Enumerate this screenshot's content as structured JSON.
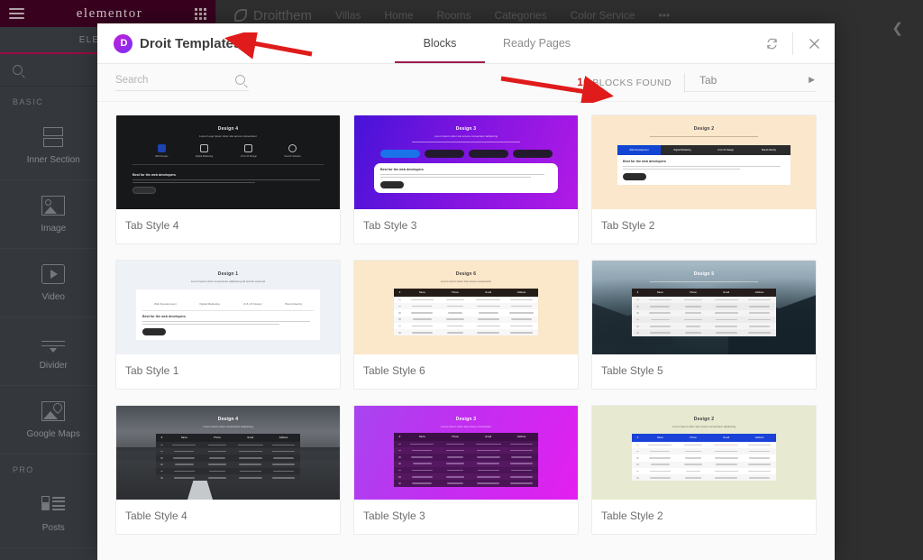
{
  "background": {
    "app_name": "elementor",
    "panel": {
      "tab_label": "ELEMENTS",
      "search_placeholder": "",
      "category_basic": "BASIC",
      "category_pro": "PRO",
      "widgets": [
        {
          "label": "Inner Section",
          "icon": "inner-section-icon"
        },
        {
          "label": "Image",
          "icon": "image-icon"
        },
        {
          "label": "Video",
          "icon": "video-icon"
        },
        {
          "label": "Divider",
          "icon": "divider-icon"
        },
        {
          "label": "Google Maps",
          "icon": "google-maps-icon"
        },
        {
          "label": "Posts",
          "icon": "posts-icon"
        }
      ]
    },
    "site_nav": {
      "brand": "Droitthem",
      "items": [
        "Villas",
        "Home",
        "Rooms",
        "Categories",
        "Color Service"
      ],
      "more_icon": "ellipsis-icon",
      "share_icon": "share-icon"
    }
  },
  "modal": {
    "brand_badge_letter": "D",
    "title": "Droit Templates",
    "tabs": [
      {
        "label": "Blocks",
        "active": true
      },
      {
        "label": "Ready Pages",
        "active": false
      }
    ],
    "refresh_icon": "refresh-icon",
    "close_icon": "close-icon",
    "toolbar": {
      "search_placeholder": "Search",
      "search_value": "",
      "search_icon": "search-icon",
      "results_count": "16",
      "results_label": "BLOCKS FOUND",
      "results_count_color": "#cf2020",
      "filter_value": "Tab",
      "filter_arrow_icon": "chevron-right-icon"
    },
    "cards": [
      {
        "label": "Tab Style 4",
        "thumb": {
          "kind": "tab-icons",
          "title": "Design 4",
          "subtitle": "Lorem Logo Ipsum dolor site amore consectetur",
          "bg": "#17181a",
          "fg": "#e8e8e8",
          "panel_bg": "transparent",
          "icons": [
            "Web Design",
            "Digital Marketing",
            "UI & UX Design",
            "Search Solution"
          ],
          "active_index": 0,
          "accent": "#1d4ed8",
          "heading": "Best for the web developers",
          "button": "Read More"
        }
      },
      {
        "label": "Tab Style 3",
        "thumb": {
          "kind": "tab-pills",
          "title": "Design 3",
          "subtitle": "Lorem Ipsum dolor site amore consectetur adipiscing",
          "bg": "linear-gradient(110deg,#4713d8 0%,#7d14e0 45%,#b31ae6 100%)",
          "fg": "#ffffff",
          "panel_bg": "#ffffff",
          "pills": [
            "Web Development",
            "Digital Marketing",
            "UI & UX Design",
            "Brand Identity"
          ],
          "active_index": 0,
          "accent": "#1a73e8",
          "heading": "Best for the web developers",
          "button": "Read More"
        }
      },
      {
        "label": "Tab Style 2",
        "thumb": {
          "kind": "tab-bar",
          "title": "Design 2",
          "subtitle": "",
          "bg": "#fbe7cb",
          "fg": "#3a3a3a",
          "panel_bg": "#ffffff",
          "bar_bg": "#2b2b2b",
          "tabs": [
            "Web Development",
            "Digital Marketing",
            "UI & UX Design",
            "Brand Identity"
          ],
          "active_index": 0,
          "accent": "#1245d4",
          "heading": "Best for the web developers",
          "button": "Read More"
        }
      },
      {
        "label": "Tab Style 1",
        "thumb": {
          "kind": "tab-plain",
          "title": "Design 1",
          "subtitle": "Lorem Ipsum dolor consectetur adipiscing elit sed do eiusmod",
          "bg": "#eef2f7",
          "fg": "#3a3a3a",
          "panel_bg": "#ffffff",
          "tabs": [
            "Web Development",
            "Digital Marketing",
            "UI & UX Design",
            "Brand Identity"
          ],
          "active_index": 0,
          "heading": "Best for the web developers",
          "button": "Read More"
        }
      },
      {
        "label": "Table Style 6",
        "thumb": {
          "kind": "table",
          "title": "Design 6",
          "subtitle": "Lorem Ipsum dolor site amore consectetur",
          "bg": "#fbe7c9",
          "fg": "#3a3a3a",
          "head_bg": "#241c16",
          "head_fg": "#ffffff",
          "body_bg": "#ffffff",
          "cell_color": "#8a8a8a",
          "columns": [
            "#",
            "Name",
            "Phone",
            "Email",
            "Address"
          ],
          "rows": 6
        }
      },
      {
        "label": "Table Style 5",
        "thumb": {
          "kind": "table-photo-forest",
          "title": "Design 5",
          "subtitle": "",
          "fg": "#ffffff",
          "head_bg": "#241c1b",
          "head_fg": "#ffffff",
          "body_bg": "#f4f4f4",
          "cell_color": "#9a9a9a",
          "columns": [
            "#",
            "Name",
            "Phone",
            "Email",
            "Address"
          ],
          "rows": 6
        }
      },
      {
        "label": "Table Style 4",
        "thumb": {
          "kind": "table-photo-road",
          "title": "Design 4",
          "subtitle": "Lorem Ipsum dolor consectetur adipiscing",
          "fg": "#ffffff",
          "head_bg": "#1f2124",
          "head_fg": "#ffffff",
          "body_bg": "#2a2c2f",
          "cell_color": "#b9bcc0",
          "columns": [
            "#",
            "Name",
            "Phone",
            "Email",
            "Address"
          ],
          "rows": 6
        }
      },
      {
        "label": "Table Style 3",
        "thumb": {
          "kind": "table",
          "title": "Design 3",
          "subtitle": "Lorem Ipsum dolor site amore consectetur",
          "bg": "linear-gradient(115deg,#a845f0 0%,#c22ef0 45%,#e41ff0 100%)",
          "fg": "#ffffff",
          "head_bg": "#3c1045",
          "head_fg": "#ffffff",
          "body_bg": "#4a1456",
          "cell_color": "#d8b6e6",
          "columns": [
            "#",
            "Name",
            "Phone",
            "Email",
            "Address"
          ],
          "rows": 7
        }
      },
      {
        "label": "Table Style 2",
        "thumb": {
          "kind": "table",
          "title": "Design 2",
          "subtitle": "Lorem Ipsum dolor site amore consectetur adipiscing",
          "bg": "#e7ead0",
          "fg": "#3a3a3a",
          "head_bg": "#1a42d8",
          "head_fg": "#ffffff",
          "body_bg": "#ffffff",
          "cell_color": "#9a9a9a",
          "columns": [
            "#",
            "Name",
            "Phone",
            "Email",
            "Address"
          ],
          "rows": 6
        }
      }
    ]
  },
  "annotations": {
    "arrow_color": "#e01b1b",
    "arrows": [
      {
        "name": "arrow-to-droit-templates"
      },
      {
        "name": "arrow-to-blocks-found"
      }
    ]
  }
}
